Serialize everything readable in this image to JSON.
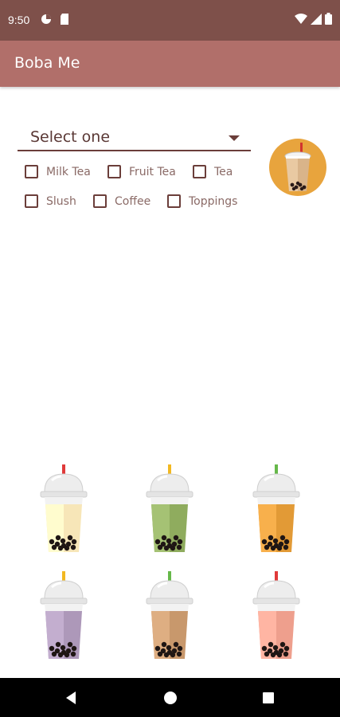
{
  "status_bar": {
    "time": "9:50",
    "left_icons": [
      "data-saver-icon",
      "sd-card-icon"
    ],
    "right_icons": [
      "wifi-icon",
      "cell-signal-icon",
      "battery-icon"
    ]
  },
  "app_bar": {
    "title": "Boba Me",
    "color": "#b16f6a"
  },
  "filter": {
    "dropdown_label": "Select one",
    "checkboxes": [
      {
        "label": "Milk Tea",
        "checked": false
      },
      {
        "label": "Fruit Tea",
        "checked": false
      },
      {
        "label": "Tea",
        "checked": false
      },
      {
        "label": "Slush",
        "checked": false
      },
      {
        "label": "Coffee",
        "checked": false
      },
      {
        "label": "Toppings",
        "checked": false
      }
    ]
  },
  "logo": {
    "icon": "boba-cup-icon"
  },
  "drinks": [
    {
      "icon": "boba-cup-icon",
      "straw": "#e03a3a",
      "tea": "#f7e6b8"
    },
    {
      "icon": "boba-cup-icon",
      "straw": "#f2b821",
      "tea": "#8fac5e"
    },
    {
      "icon": "boba-cup-icon",
      "straw": "#66b84a",
      "tea": "#e29a36"
    },
    {
      "icon": "boba-cup-icon",
      "straw": "#f2b821",
      "tea": "#ad98b9"
    },
    {
      "icon": "boba-cup-icon",
      "straw": "#66b84a",
      "tea": "#c8986c"
    },
    {
      "icon": "boba-cup-icon",
      "straw": "#e03a3a",
      "tea": "#ee9f8d"
    }
  ],
  "nav_bar": {
    "buttons": [
      "back-icon",
      "home-icon",
      "recents-icon"
    ]
  }
}
